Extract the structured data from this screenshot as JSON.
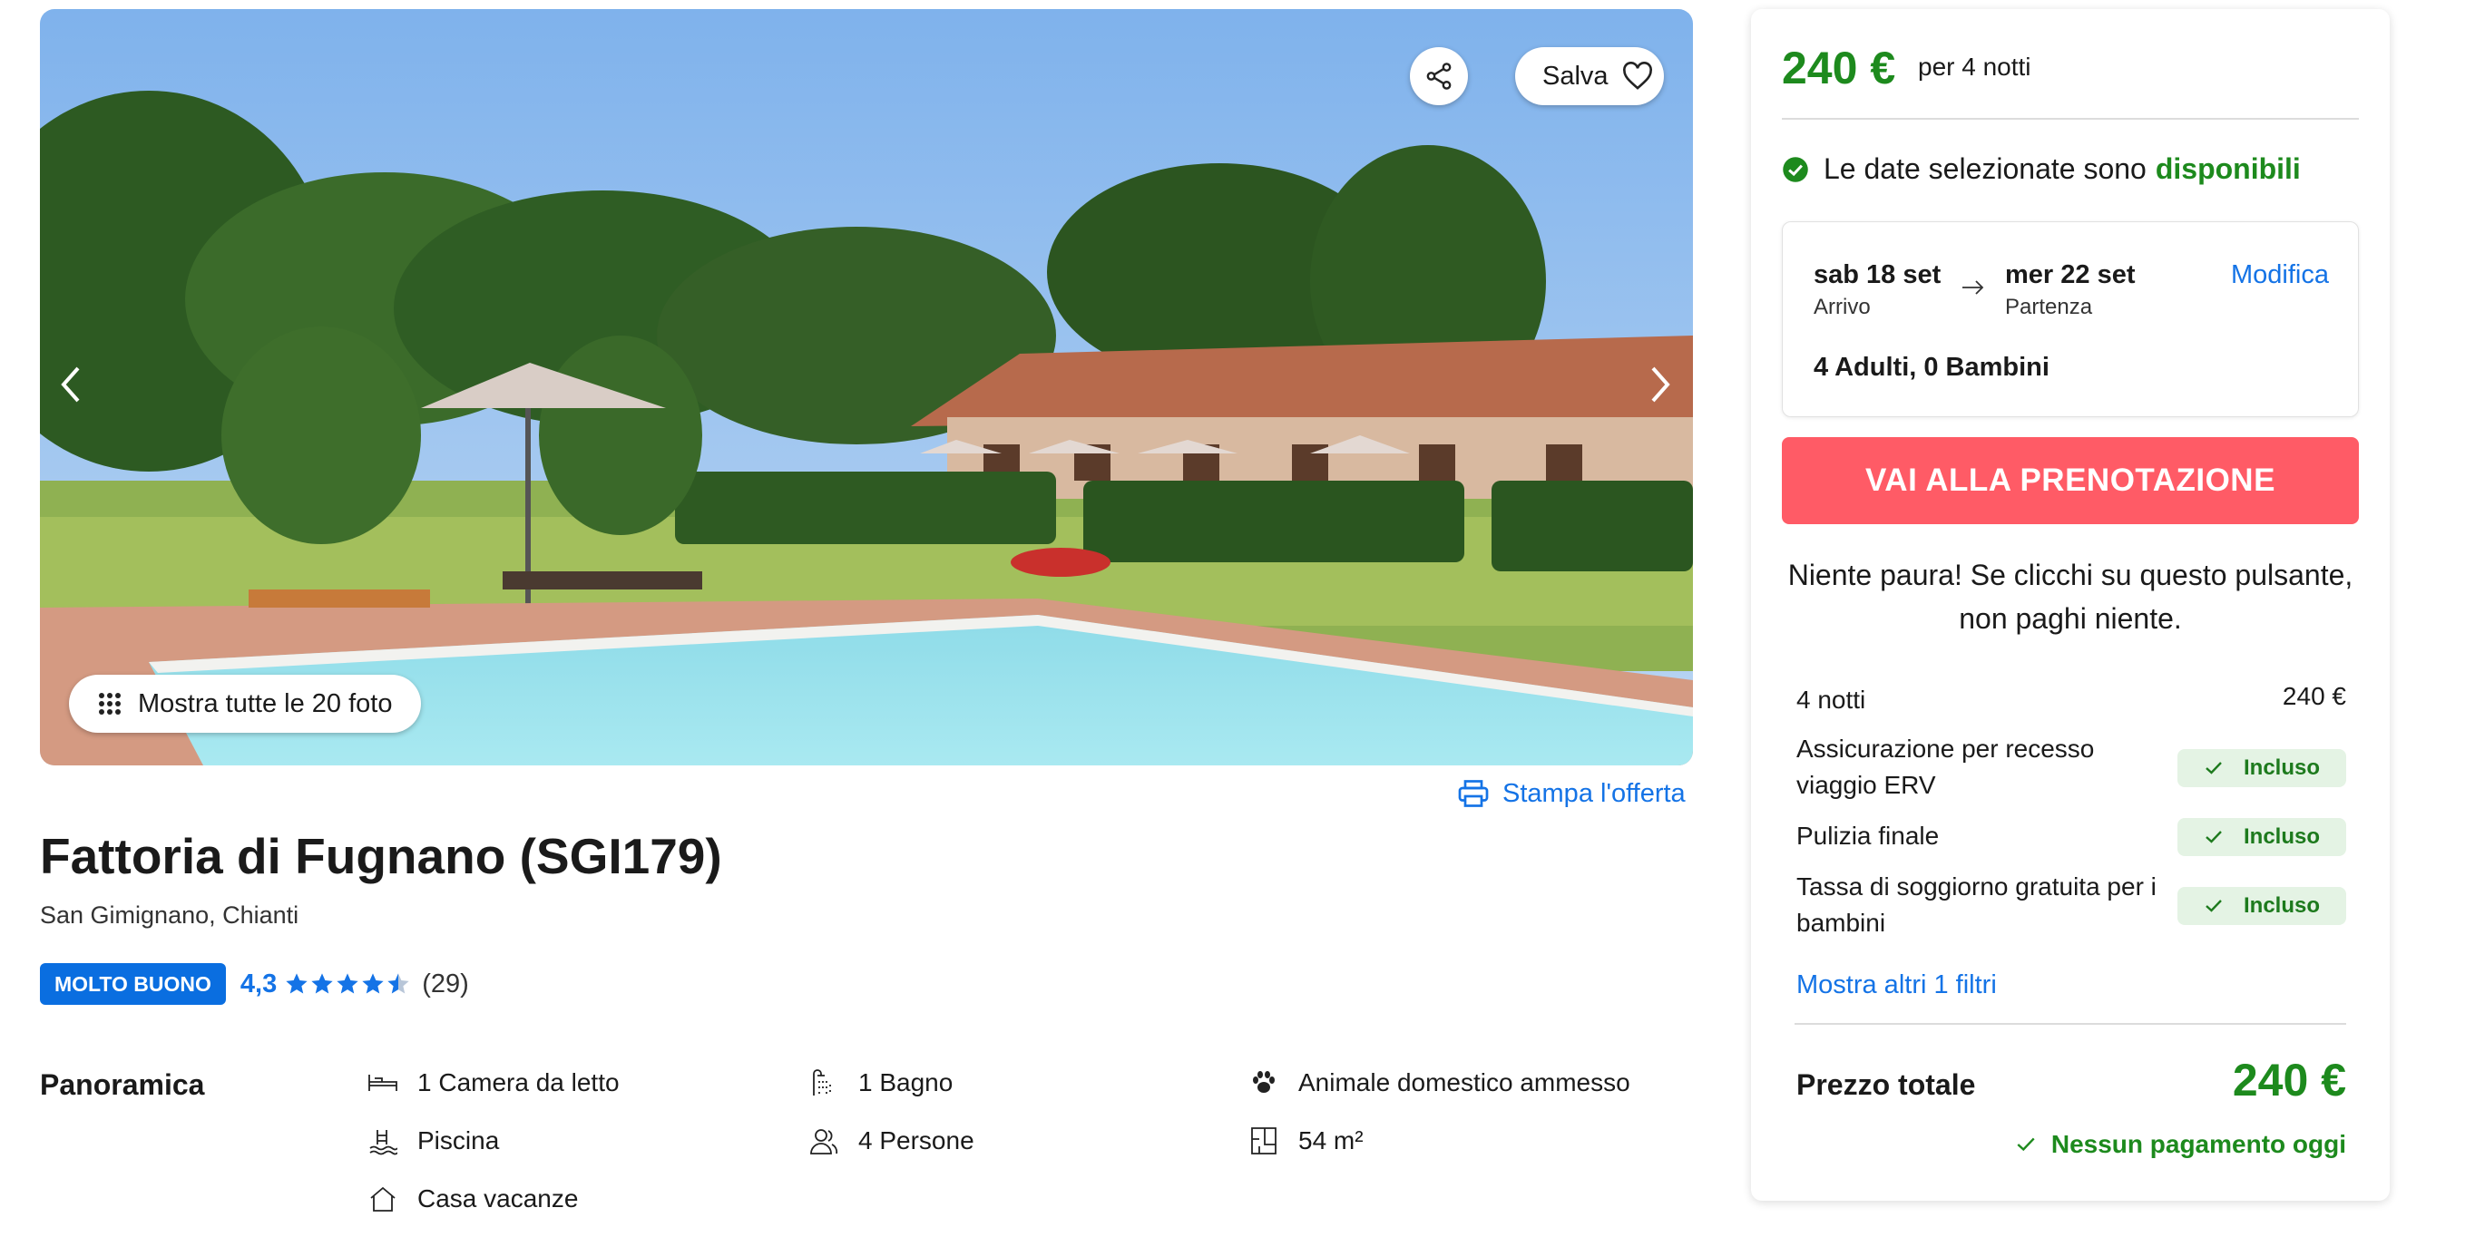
{
  "gallery": {
    "save_label": "Salva",
    "show_all_label": "Mostra tutte le 20 foto",
    "print_label": "Stampa l'offerta"
  },
  "property": {
    "title": "Fattoria di Fugnano (SGI179)",
    "location": "San Gimignano, Chianti",
    "badge": "MOLTO BUONO",
    "score": "4,3",
    "stars": 4.3,
    "reviews": "(29)"
  },
  "overview": {
    "title": "Panoramica",
    "features": [
      {
        "icon": "bed-icon",
        "label": "1 Camera da letto"
      },
      {
        "icon": "shower-icon",
        "label": "1 Bagno"
      },
      {
        "icon": "paw-icon",
        "label": "Animale domestico ammesso"
      },
      {
        "icon": "pool-icon",
        "label": "Piscina"
      },
      {
        "icon": "persons-icon",
        "label": "4 Persone"
      },
      {
        "icon": "floorplan-icon",
        "label": "54 m²"
      },
      {
        "icon": "house-icon",
        "label": "Casa vacanze"
      }
    ]
  },
  "booking": {
    "price": "240 €",
    "per_nights": "per 4 notti",
    "availability_text": "Le date selezionate sono",
    "availability_status": "disponibili",
    "checkin_date": "sab 18 set",
    "checkin_label": "Arrivo",
    "checkout_date": "mer 22 set",
    "checkout_label": "Partenza",
    "modify_label": "Modifica",
    "guests": "4 Adulti, 0 Bambini",
    "cta": "VAI ALLA PRENOTAZIONE",
    "reassurance": "Niente paura! Se clicchi su questo pulsante, non paghi niente.",
    "nights_label": "4 notti",
    "nights_price": "240 €",
    "included": [
      {
        "label": "Assicurazione per recesso viaggio ERV",
        "value": "Incluso"
      },
      {
        "label": "Pulizia finale",
        "value": "Incluso"
      },
      {
        "label": "Tassa di soggiorno gratuita per i bambini",
        "value": "Incluso"
      }
    ],
    "more_filters": "Mostra altri 1 filtri",
    "total_label": "Prezzo totale",
    "total_price": "240 €",
    "no_payment": "Nessun pagamento oggi"
  },
  "colors": {
    "accent_blue": "#1473e6",
    "price_green": "#1d8a1d",
    "cta_red": "#ff5b66",
    "badge_blue": "#0a6ee0"
  }
}
